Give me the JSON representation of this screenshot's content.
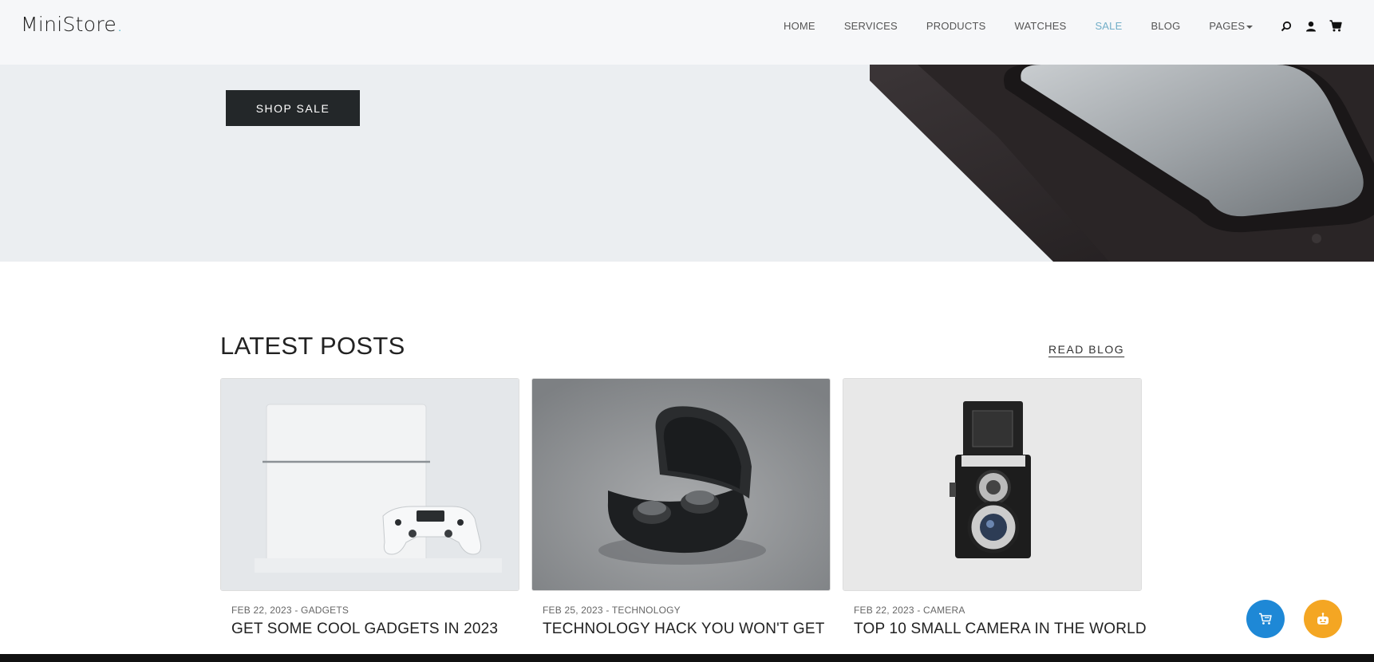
{
  "header": {
    "logo_text": "MiniStore",
    "logo_dot": ".",
    "nav": [
      {
        "label": "HOME"
      },
      {
        "label": "SERVICES"
      },
      {
        "label": "PRODUCTS"
      },
      {
        "label": "WATCHES"
      },
      {
        "label": "SALE",
        "active": true
      },
      {
        "label": "BLOG"
      },
      {
        "label": "PAGES"
      }
    ],
    "icons": [
      "search-icon",
      "user-icon",
      "cart-icon"
    ]
  },
  "hero": {
    "button_label": "SHOP SALE"
  },
  "posts": {
    "title": "LATEST POSTS",
    "read_blog": "READ BLOG",
    "items": [
      {
        "meta": "FEB 22, 2023 - GADGETS",
        "title": "GET SOME COOL GADGETS IN 2023"
      },
      {
        "meta": "FEB 25, 2023 - TECHNOLOGY",
        "title": "TECHNOLOGY HACK YOU WON'T GET"
      },
      {
        "meta": "FEB 22, 2023 - CAMERA",
        "title": "TOP 10 SMALL CAMERA IN THE WORLD"
      }
    ]
  },
  "floating": {
    "cart_color": "#1e88d6",
    "bot_color": "#f4a623"
  },
  "colors": {
    "accent": "#72aec8",
    "dark": "#232729"
  }
}
